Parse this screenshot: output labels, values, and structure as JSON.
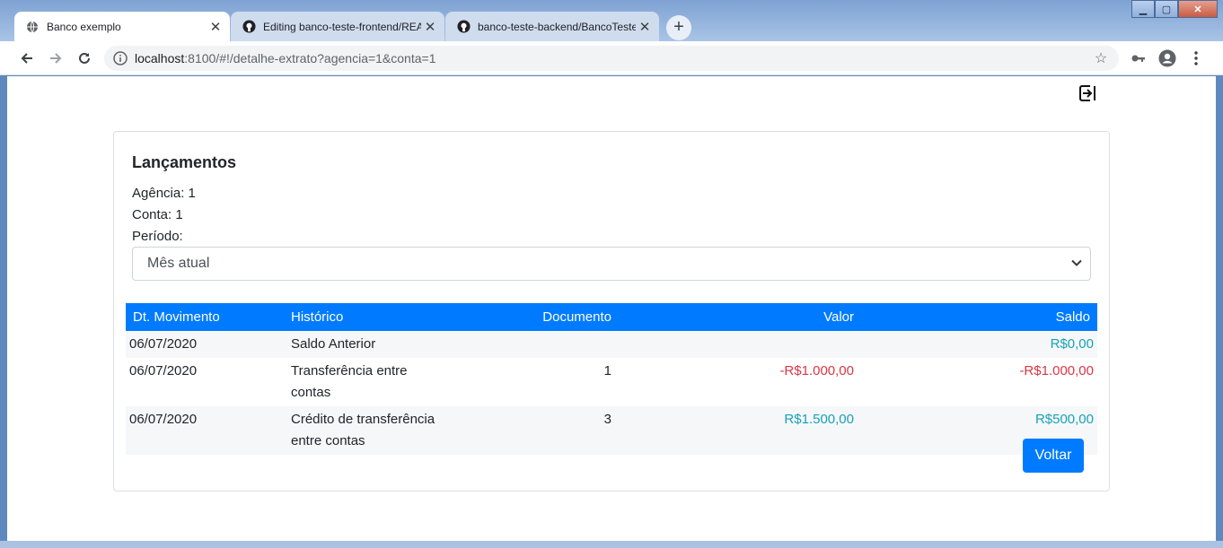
{
  "browser": {
    "tabs": [
      {
        "title": "Banco exemplo",
        "icon": "globe-icon",
        "active": true
      },
      {
        "title": "Editing banco-teste-frontend/README",
        "icon": "github-icon",
        "active": false
      },
      {
        "title": "banco-teste-backend/BancoTeste",
        "icon": "github-icon",
        "active": false
      }
    ],
    "new_tab": "+",
    "url_host": "localhost",
    "url_path": ":8100/#!/detalhe-extrato?agencia=1&conta=1"
  },
  "card": {
    "title": "Lançamentos",
    "agencia": "Agência: 1",
    "conta": "Conta: 1",
    "periodo_label": "Período:",
    "periodo_selected": "Mês atual"
  },
  "table": {
    "headers": [
      "Dt. Movimento",
      "Histórico",
      "Documento",
      "Valor",
      "Saldo"
    ],
    "rows": [
      {
        "data": "06/07/2020",
        "historico": "Saldo Anterior",
        "documento": "",
        "valor": "",
        "saldo": "R$0,00"
      },
      {
        "data": "06/07/2020",
        "historico": "Transferência entre contas",
        "documento": "1",
        "valor": "-R$1.000,00",
        "saldo": "-R$1.000,00"
      },
      {
        "data": "06/07/2020",
        "historico": "Crédito de transferência entre contas",
        "documento": "3",
        "valor": "R$1.500,00",
        "saldo": "R$500,00"
      }
    ]
  },
  "voltar_label": "Voltar",
  "colors": {
    "primary": "#007bff",
    "negative": "#dc3545",
    "positive": "#17a2b8"
  }
}
